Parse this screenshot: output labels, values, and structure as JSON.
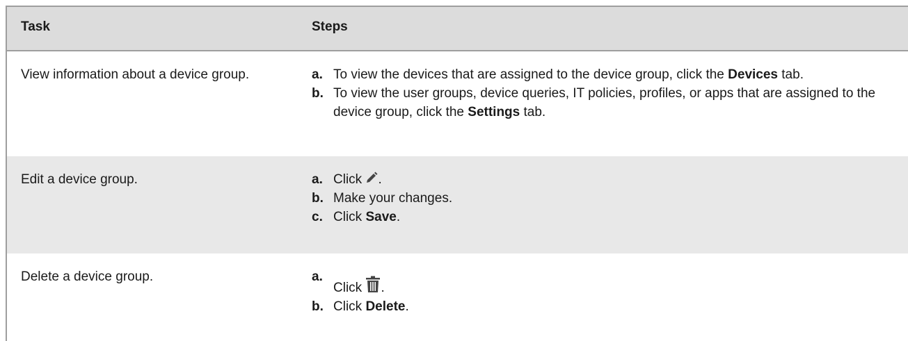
{
  "table": {
    "headers": {
      "task": "Task",
      "steps": "Steps"
    },
    "rows": [
      {
        "task": "View information about a device group.",
        "steps": [
          {
            "letter": "a.",
            "pre": "To view the devices that are assigned to the device group, click the ",
            "bold": "Devices",
            "post": " tab."
          },
          {
            "letter": "b.",
            "pre": "To view the user groups, device queries, IT policies, profiles, or apps that are assigned to the device group, click the ",
            "bold": "Settings",
            "post": " tab."
          }
        ]
      },
      {
        "task": "Edit a device group.",
        "steps": [
          {
            "letter": "a.",
            "pre": "Click ",
            "icon": "pencil-icon",
            "post": "."
          },
          {
            "letter": "b.",
            "pre": "Make your changes."
          },
          {
            "letter": "c.",
            "pre": "Click ",
            "bold": "Save",
            "post": "."
          }
        ]
      },
      {
        "task": "Delete a device group.",
        "steps": [
          {
            "letter": "a.",
            "pre": "Click ",
            "icon": "trash-icon",
            "post": "."
          },
          {
            "letter": "b.",
            "pre": "Click ",
            "bold": "Delete",
            "post": "."
          }
        ]
      }
    ]
  },
  "colors": {
    "header_bg": "#dcdcdc",
    "alt_row_bg": "#e8e8e8",
    "border": "#9e9e9e",
    "icon": "#444444"
  }
}
